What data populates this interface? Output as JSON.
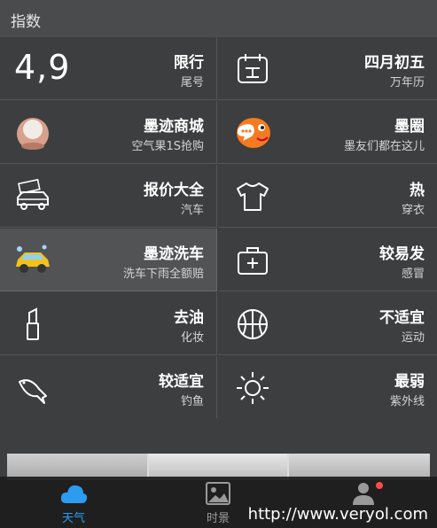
{
  "header": {
    "title": "指数"
  },
  "cells": [
    {
      "primary": "限行",
      "secondary": "尾号",
      "big": "4,9",
      "icon": "none"
    },
    {
      "primary": "四月初五",
      "secondary": "万年历",
      "icon": "calendar-icon"
    },
    {
      "primary": "墨迹商城",
      "secondary": "空气果1S抢购",
      "icon": "air-fruit-icon"
    },
    {
      "primary": "墨圈",
      "secondary": "墨友们都在这儿",
      "icon": "chat-bird-icon"
    },
    {
      "primary": "报价大全",
      "secondary": "汽车",
      "icon": "car-price-icon"
    },
    {
      "primary": "热",
      "secondary": "穿衣",
      "icon": "tshirt-icon"
    },
    {
      "primary": "墨迹洗车",
      "secondary": "洗车下雨全额赔",
      "icon": "yellow-car-icon"
    },
    {
      "primary": "较易发",
      "secondary": "感冒",
      "icon": "medical-kit-icon"
    },
    {
      "primary": "去油",
      "secondary": "化妆",
      "icon": "lipstick-icon"
    },
    {
      "primary": "不适宜",
      "secondary": "运动",
      "icon": "basketball-icon"
    },
    {
      "primary": "较适宜",
      "secondary": "钓鱼",
      "icon": "fish-icon"
    },
    {
      "primary": "最弱",
      "secondary": "紫外线",
      "icon": "sun-icon"
    }
  ],
  "tabs": [
    {
      "label": "天气",
      "icon": "cloud-icon",
      "active": true
    },
    {
      "label": "时景",
      "icon": "photo-icon",
      "active": false
    },
    {
      "label": "",
      "icon": "person-icon",
      "active": false
    }
  ],
  "watermark": "http://www.veryol.com",
  "colors": {
    "accent": "#2b9cf0",
    "background": "#3d3e3f",
    "badge": "#ff4a4a"
  }
}
